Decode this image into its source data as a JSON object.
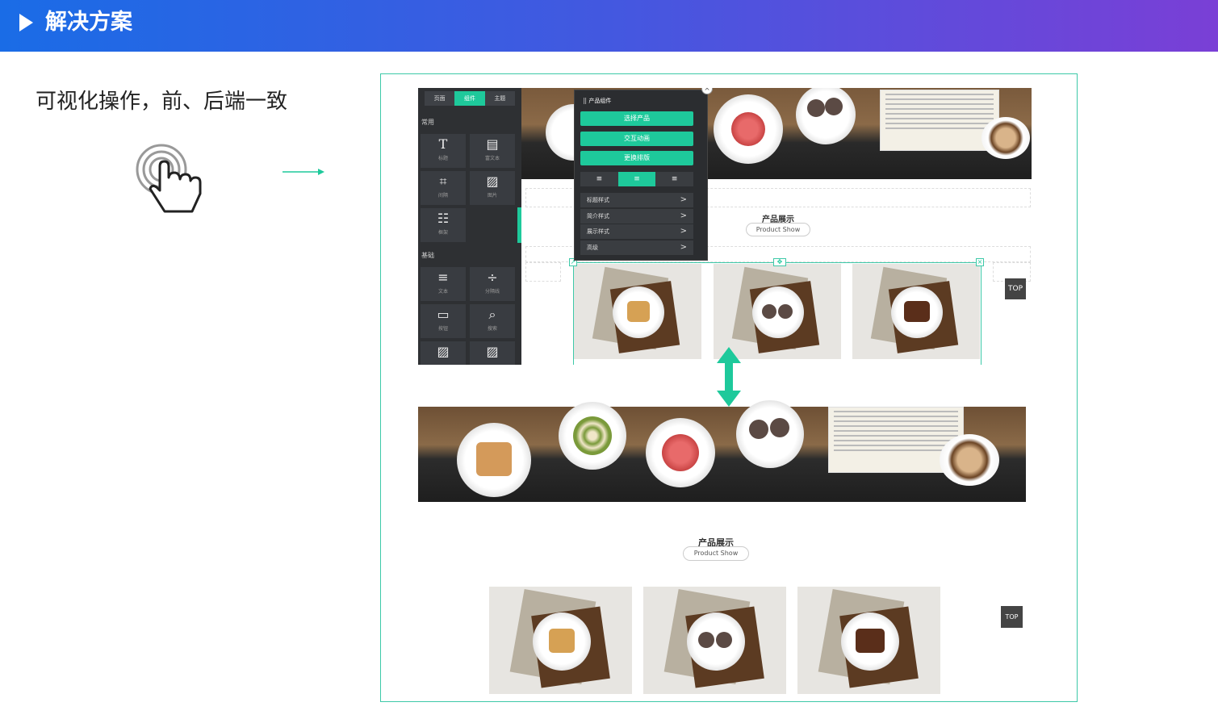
{
  "banner": {
    "title": "解决方案",
    "accent": "#1a6ce6"
  },
  "subtitle": "可视化操作，前、后端一致",
  "editor": {
    "tabs": [
      "页面",
      "组件",
      "主题"
    ],
    "active_tab": "组件",
    "section_common": "常用",
    "section_basic": "基础",
    "tiles": [
      {
        "icon": "T",
        "label": "标题",
        "icon_name": "title-icon"
      },
      {
        "icon": "▤",
        "label": "富文本",
        "icon_name": "rich-text-icon"
      },
      {
        "icon": "⌗",
        "label": "间隔",
        "icon_name": "spacing-icon"
      },
      {
        "icon": "▨",
        "label": "图片",
        "icon_name": "image-icon"
      },
      {
        "icon": "☷",
        "label": "框架",
        "icon_name": "frame-icon"
      },
      {
        "icon": "≡",
        "label": "文本",
        "icon_name": "text-icon"
      },
      {
        "icon": "÷",
        "label": "分隔线",
        "icon_name": "divider-icon"
      },
      {
        "icon": "▭",
        "label": "按钮",
        "icon_name": "button-icon"
      },
      {
        "icon": "⌕",
        "label": "搜索",
        "icon_name": "search-icon"
      },
      {
        "icon": "▨",
        "label": "",
        "icon_name": "image-icon"
      },
      {
        "icon": "▨",
        "label": "",
        "icon_name": "image-icon"
      }
    ],
    "popup": {
      "header": "产品组件",
      "buttons": [
        "选择产品",
        "交互动画",
        "更换排版"
      ],
      "align": [
        "≡",
        "≡",
        "≡"
      ],
      "rows": [
        "标题样式",
        "简介样式",
        "展示样式",
        "高级"
      ]
    },
    "section_title": "产品展示",
    "section_sub": "Product Show",
    "top_label": "TOP"
  },
  "frontend": {
    "section_title": "产品展示",
    "section_sub": "Product Show",
    "top_label": "TOP"
  },
  "colors": {
    "green": "#1ec99b",
    "frame": "#3dc9a8",
    "panel": "#2e3033"
  }
}
